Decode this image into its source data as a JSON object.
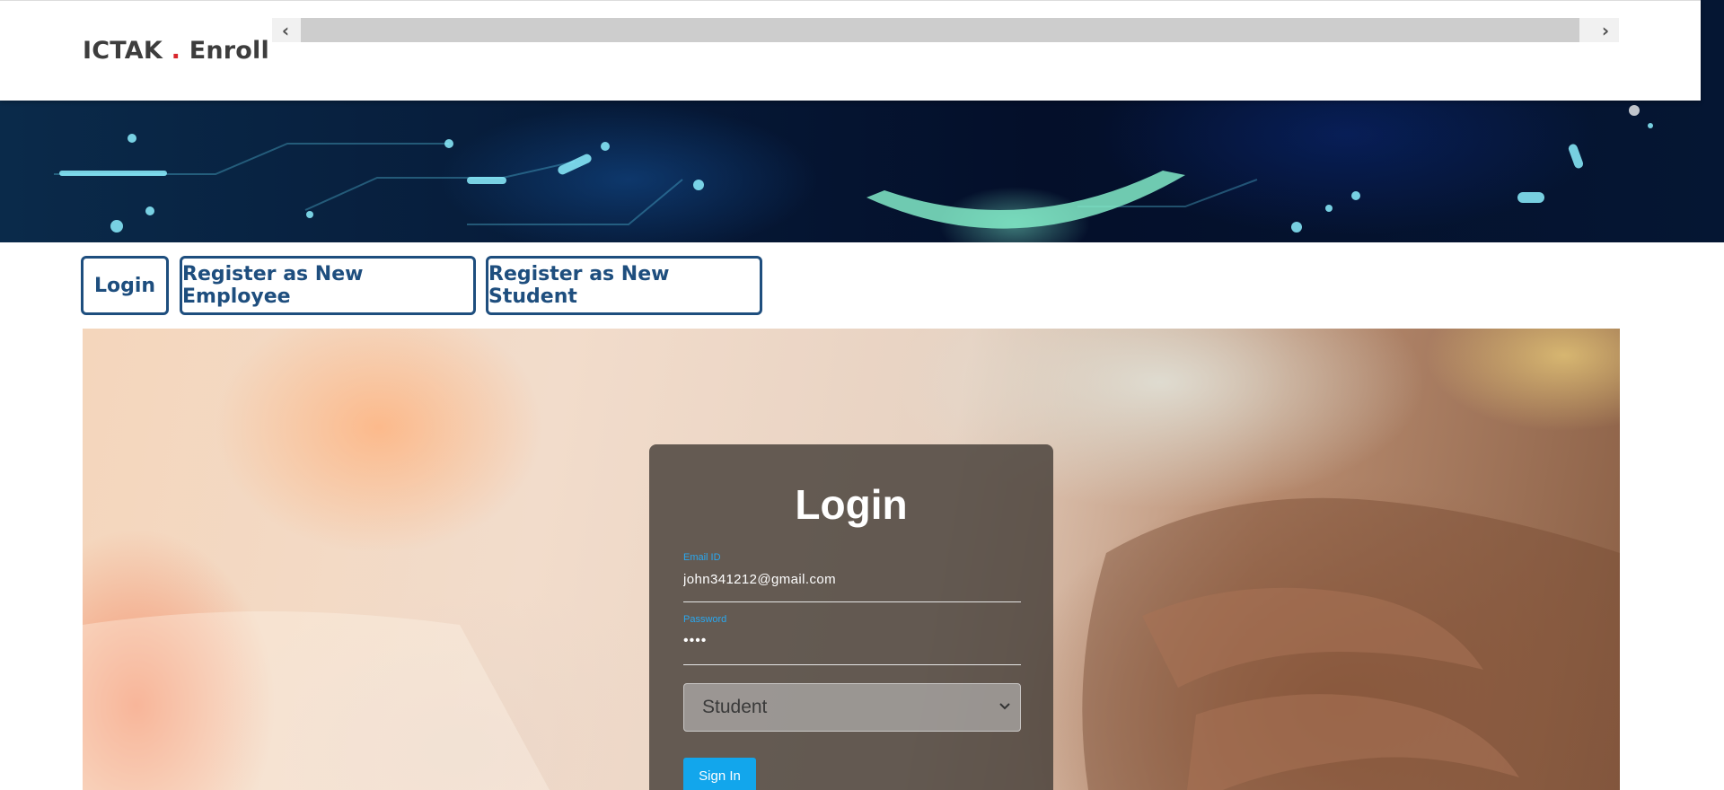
{
  "header": {
    "brand_prefix": "ICTAK",
    "brand_dot": ".",
    "brand_suffix": "Enroll",
    "scroll_left_icon": "chevron-left-icon",
    "scroll_right_icon": "chevron-right-icon"
  },
  "tabs": [
    {
      "label": "Login"
    },
    {
      "label": "Register as New Employee"
    },
    {
      "label": "Register as New Student"
    }
  ],
  "login_form": {
    "title": "Login",
    "email_label": "Email ID",
    "email_value": "john341212@gmail.com",
    "password_label": "Password",
    "password_value": "••••",
    "role_selected": "Student",
    "submit_label": "Sign In"
  },
  "colors": {
    "primary_blue": "#1e4e7e",
    "accent_red": "#d9262c",
    "label_blue": "#29a8f0",
    "button_blue": "#12a6ec"
  }
}
